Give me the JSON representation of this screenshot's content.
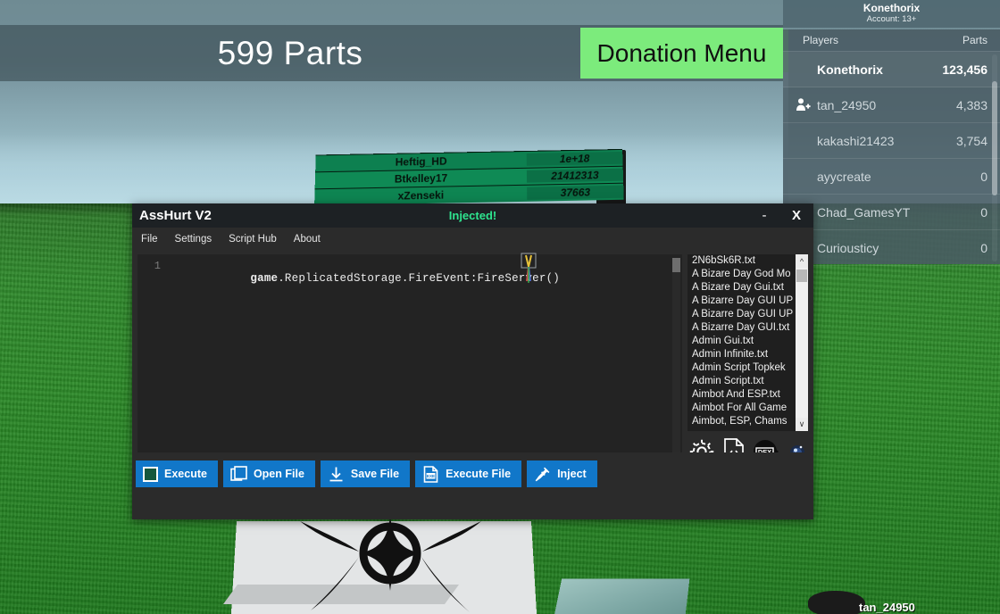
{
  "game_hud": {
    "parts_counter": "599 Parts",
    "donation_menu_label": "Donation Menu",
    "account": {
      "name": "Konethorix",
      "sub": "Account: 13+"
    },
    "bottom_nametag": "tan_24950"
  },
  "billboard": {
    "rows": [
      {
        "name": "Heftig_HD",
        "value": "1e+18"
      },
      {
        "name": "Btkelley17",
        "value": "21412313"
      },
      {
        "name": "xZenseki",
        "value": "37663"
      }
    ]
  },
  "player_list": {
    "col_players": "Players",
    "col_parts": "Parts",
    "rows": [
      {
        "name": "Konethorix",
        "parts": "123,456",
        "self": true,
        "icon": ""
      },
      {
        "name": "tan_24950",
        "parts": "4,383",
        "self": false,
        "icon": "add-friend-icon"
      },
      {
        "name": "kakashi21423",
        "parts": "3,754",
        "self": false,
        "icon": ""
      },
      {
        "name": "ayycreate",
        "parts": "0",
        "self": false,
        "icon": ""
      },
      {
        "name": "Chad_GamesYT",
        "parts": "0",
        "self": false,
        "icon": ""
      },
      {
        "name": "Curiousticy",
        "parts": "0",
        "self": false,
        "icon": ""
      }
    ]
  },
  "exploit_window": {
    "title": "AssHurt V2",
    "status": "Injected!",
    "minimize_label": "-",
    "close_label": "X",
    "menu": [
      {
        "label": "File"
      },
      {
        "label": "Settings"
      },
      {
        "label": "Script Hub"
      },
      {
        "label": "About"
      }
    ],
    "editor": {
      "line_number": "1",
      "code_prefix": "game",
      "code_rest": ".ReplicatedStorage.FireEvent:FireServer()"
    },
    "script_list": [
      {
        "label": "2N6bSk6R.txt"
      },
      {
        "label": "A Bizare Day God Mo"
      },
      {
        "label": "A Bizare Day Gui.txt"
      },
      {
        "label": "A Bizarre Day GUI UP"
      },
      {
        "label": "A Bizarre Day GUI UP"
      },
      {
        "label": "A Bizarre Day GUI.txt"
      },
      {
        "label": "Admin Gui.txt"
      },
      {
        "label": "Admin Infinite.txt"
      },
      {
        "label": "Admin Script Topkek"
      },
      {
        "label": "Admin Script.txt"
      },
      {
        "label": "Aimbot And ESP.txt"
      },
      {
        "label": "Aimbot For All Game"
      },
      {
        "label": "Aimbot, ESP, Chams"
      }
    ],
    "icons": [
      {
        "name": "gear-icon"
      },
      {
        "name": "code-file-icon"
      },
      {
        "name": "dex-explorer-icon"
      },
      {
        "name": "orb-icon"
      },
      {
        "name": "orange-logo-icon"
      }
    ],
    "buttons": [
      {
        "label": "Execute",
        "icon": "green-square-icon"
      },
      {
        "label": "Open File",
        "icon": "folder-icon"
      },
      {
        "label": "Save File",
        "icon": "download-arrow-icon"
      },
      {
        "label": "Execute File",
        "icon": "exe-file-icon"
      },
      {
        "label": "Inject",
        "icon": "syringe-icon"
      }
    ]
  },
  "colors": {
    "accent_blue": "#1177c9",
    "injected_green": "#2ee58f",
    "donation_green": "#7ceb7c",
    "window_bg": "#2b2b2b",
    "titlebar_bg": "#1d2124",
    "editor_bg": "#232323"
  }
}
